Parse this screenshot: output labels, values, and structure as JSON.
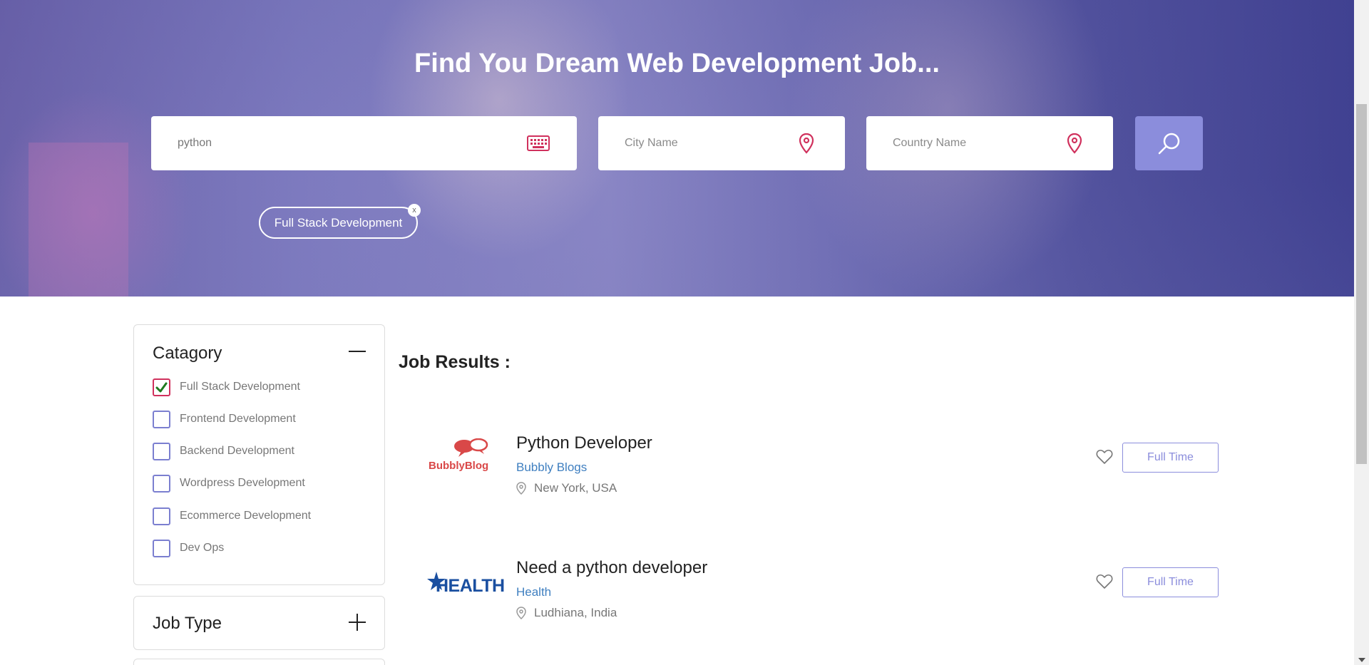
{
  "hero": {
    "title": "Find You Dream Web Development Job...",
    "search_value": "python",
    "city_placeholder": "City Name",
    "country_placeholder": "Country Name",
    "active_tag": "Full Stack Development",
    "tag_close": "x"
  },
  "sidebar": {
    "category_heading": "Catagory",
    "categories": [
      {
        "label": "Full Stack Development",
        "checked": true
      },
      {
        "label": "Frontend Development",
        "checked": false
      },
      {
        "label": "Backend Development",
        "checked": false
      },
      {
        "label": "Wordpress Development",
        "checked": false
      },
      {
        "label": "Ecommerce Development",
        "checked": false
      },
      {
        "label": "Dev Ops",
        "checked": false
      }
    ],
    "jobtype_heading": "Job Type"
  },
  "results": {
    "title": "Job Results :",
    "jobs": [
      {
        "logo_text": "BubblyBlog",
        "title": "Python Developer",
        "company": "Bubbly Blogs",
        "location": "New York, USA",
        "type": "Full Time"
      },
      {
        "logo_text": "HEALTH",
        "title": "Need a python developer",
        "company": "Health",
        "location": "Ludhiana, India",
        "type": "Full Time"
      }
    ]
  },
  "colors": {
    "accent": "#8b8ddc",
    "pin": "#d0315d",
    "link": "#3f7fc0"
  }
}
